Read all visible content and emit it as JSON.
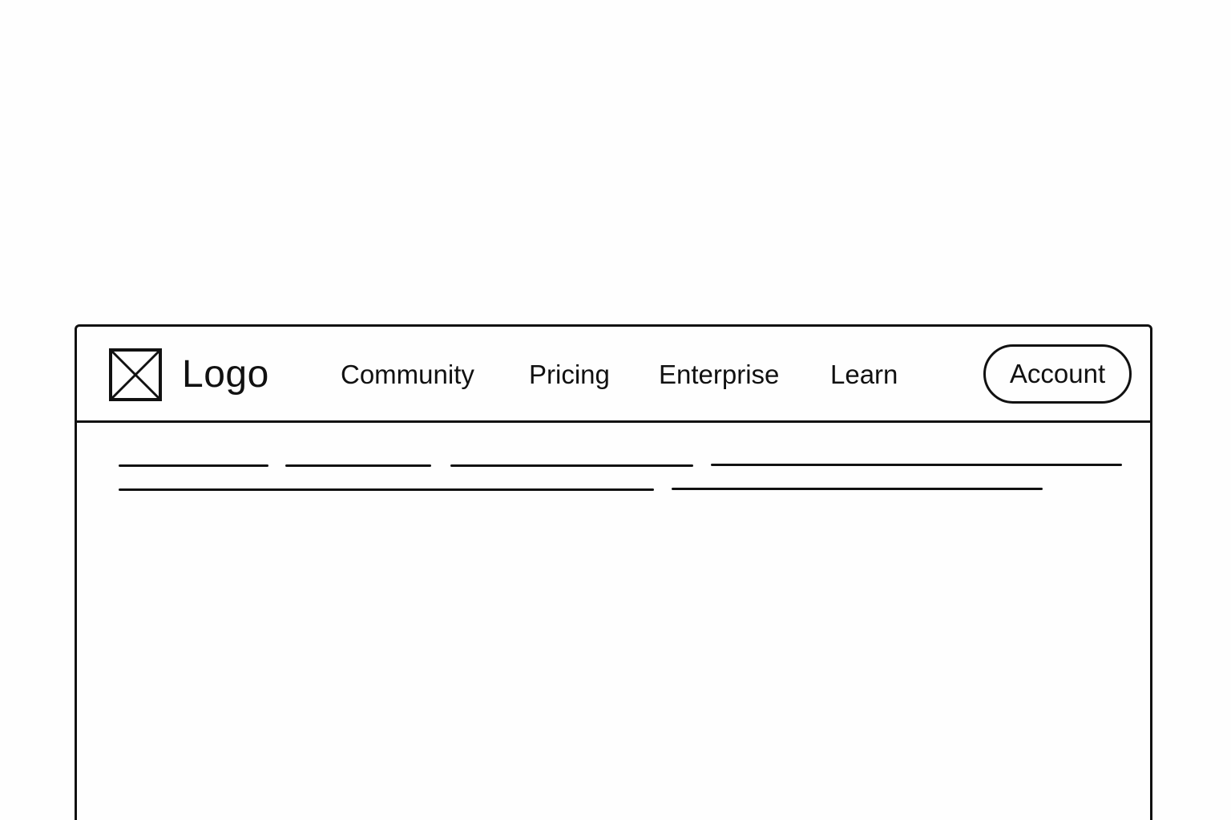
{
  "header": {
    "logo_icon": "image-placeholder-icon",
    "logo_text": "Logo",
    "nav": [
      {
        "label": "Community"
      },
      {
        "label": "Pricing"
      },
      {
        "label": "Enterprise"
      },
      {
        "label": "Learn"
      }
    ],
    "account_label": "Account"
  },
  "main": {
    "placeholder_text_rows": 2
  },
  "colors": {
    "background": "#fefefe",
    "stroke": "#111111"
  }
}
